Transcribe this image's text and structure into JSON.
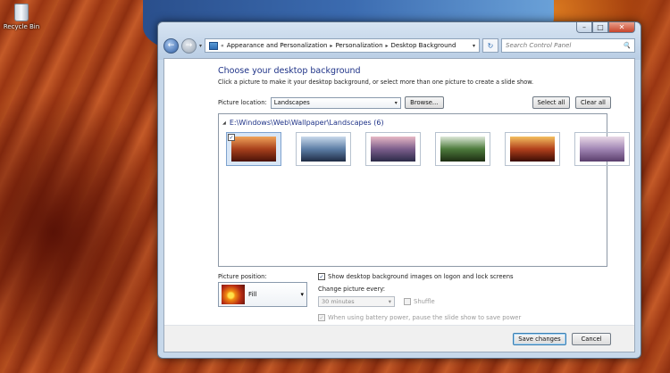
{
  "desktop": {
    "icons": [
      {
        "label": "Recycle Bin",
        "icon": "recycle-bin-icon"
      }
    ]
  },
  "window": {
    "controls": {
      "minimize": "–",
      "maximize": "□",
      "close": "✕"
    },
    "nav": {
      "back": "←",
      "forward": "→",
      "menu": "▾",
      "refresh": "↻"
    },
    "address": {
      "sep": "«",
      "crumbs": [
        "Appearance and Personalization",
        "Personalization",
        "Desktop Background"
      ],
      "arrow": "▸",
      "dropdown": "▾"
    },
    "search": {
      "placeholder": "Search Control Panel",
      "icon": "🔍"
    }
  },
  "page": {
    "heading": "Choose your desktop background",
    "description": "Click a picture to make it your desktop background, or select more than one picture to create a slide show.",
    "picture_location": {
      "label": "Picture location:",
      "value": "Landscapes",
      "arrow": "▾"
    },
    "browse_label": "Browse...",
    "select_all_label": "Select all",
    "clear_all_label": "Clear all",
    "folder": {
      "toggle": "◢",
      "path": "E:\\Windows\\Web\\Wallpaper\\Landscapes (6)"
    },
    "thumbnails": [
      {
        "name": "canyon-arch",
        "selected": true,
        "check": "✓",
        "colors": [
          "#f0a35a",
          "#a8401c",
          "#4a1208"
        ]
      },
      {
        "name": "lake-rocks",
        "selected": false,
        "check": "",
        "colors": [
          "#c9d9ec",
          "#5d7ea6",
          "#1f2c44"
        ]
      },
      {
        "name": "coast-sunset",
        "selected": false,
        "check": "",
        "colors": [
          "#e7b8c5",
          "#7c5e8c",
          "#2b2a48"
        ]
      },
      {
        "name": "waterfall",
        "selected": false,
        "check": "",
        "colors": [
          "#dde8d8",
          "#4d7b3c",
          "#1d2d12"
        ]
      },
      {
        "name": "rock-window",
        "selected": false,
        "check": "",
        "colors": [
          "#f4c060",
          "#b2401c",
          "#3a0c04"
        ]
      },
      {
        "name": "lavender-field",
        "selected": false,
        "check": "",
        "colors": [
          "#e9d9e6",
          "#a186b4",
          "#5a3e6c"
        ]
      }
    ],
    "picture_position": {
      "label": "Picture position:",
      "value": "Fill",
      "arrow": "▾"
    },
    "show_on_logon": {
      "label": "Show desktop background images on logon and lock screens",
      "check": "✓"
    },
    "change_every": {
      "label": "Change picture every:",
      "value": "30 minutes",
      "arrow": "▾"
    },
    "shuffle": {
      "label": "Shuffle",
      "check": ""
    },
    "battery": {
      "label": "When using battery power, pause the slide show to save power",
      "check": "✓"
    },
    "save_label": "Save changes",
    "cancel_label": "Cancel"
  }
}
